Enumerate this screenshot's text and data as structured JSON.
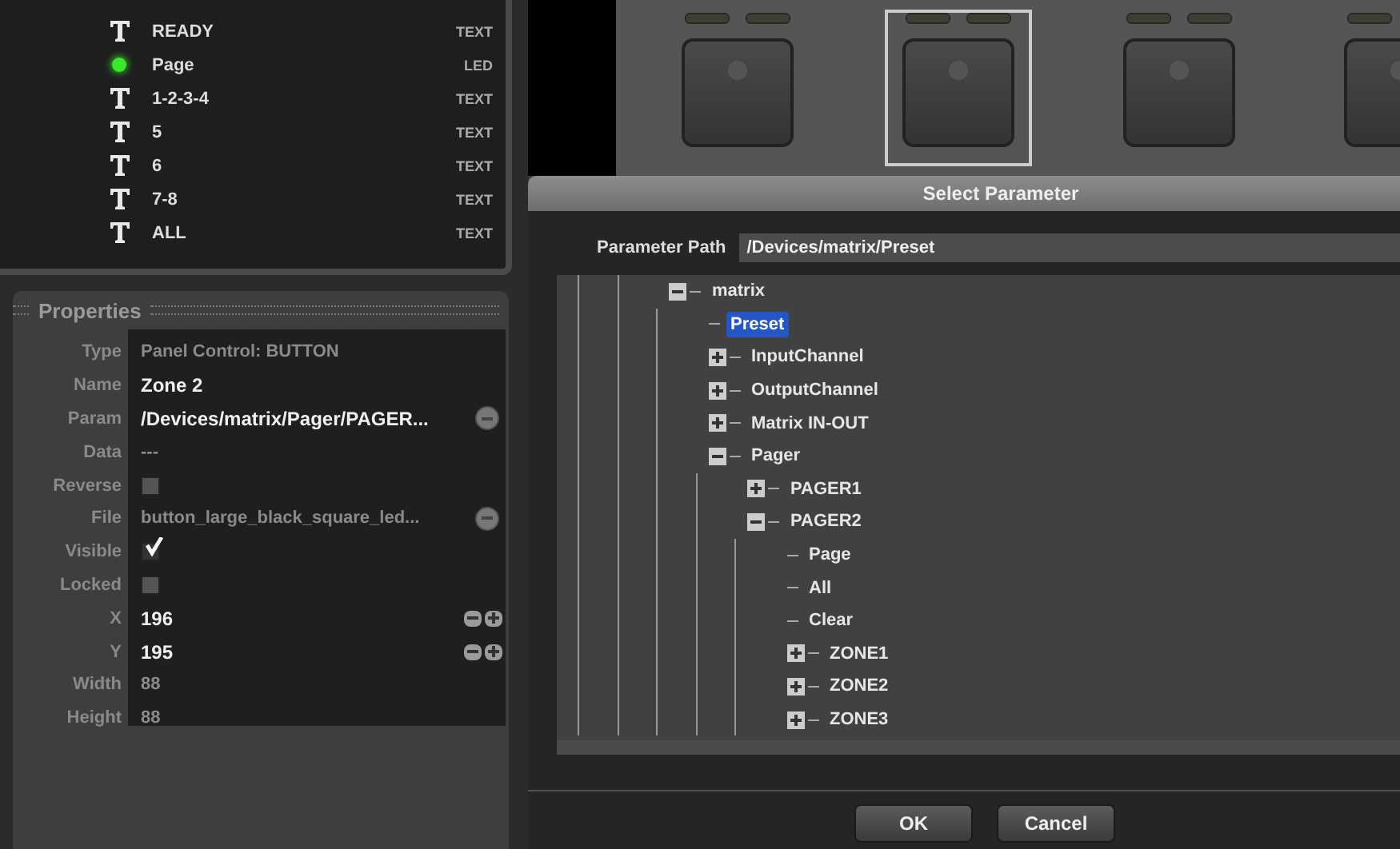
{
  "control_list": [
    {
      "kind": "text",
      "label": "READY",
      "type": "TEXT"
    },
    {
      "kind": "led",
      "label": "Page",
      "type": "LED"
    },
    {
      "kind": "text",
      "label": "1-2-3-4",
      "type": "TEXT"
    },
    {
      "kind": "text",
      "label": "5",
      "type": "TEXT"
    },
    {
      "kind": "text",
      "label": "6",
      "type": "TEXT"
    },
    {
      "kind": "text",
      "label": "7-8",
      "type": "TEXT"
    },
    {
      "kind": "text",
      "label": "ALL",
      "type": "TEXT"
    }
  ],
  "properties": {
    "title": "Properties",
    "rows": [
      {
        "kind": "text",
        "label": "Type",
        "value": "Panel Control: BUTTON",
        "disabled": true
      },
      {
        "kind": "text",
        "label": "Name",
        "value": "Zone 2",
        "disabled": false
      },
      {
        "kind": "browse",
        "label": "Param",
        "value": "/Devices/matrix/Pager/PAGER...",
        "disabled": false
      },
      {
        "kind": "text",
        "label": "Data",
        "value": "---",
        "disabled": true
      },
      {
        "kind": "checkbox",
        "label": "Reverse",
        "checked": false
      },
      {
        "kind": "browse",
        "label": "File",
        "value": "button_large_black_square_led...",
        "disabled": true
      },
      {
        "kind": "checkbox",
        "label": "Visible",
        "checked": true
      },
      {
        "kind": "checkbox",
        "label": "Locked",
        "checked": false
      },
      {
        "kind": "number",
        "label": "X",
        "value": "196",
        "disabled": false
      },
      {
        "kind": "number",
        "label": "Y",
        "value": "195",
        "disabled": false
      },
      {
        "kind": "text",
        "label": "Width",
        "value": "88",
        "disabled": true
      },
      {
        "kind": "text",
        "label": "Height",
        "value": "88",
        "disabled": true
      }
    ]
  },
  "canvas_buttons": [
    {
      "selected": false
    },
    {
      "selected": true
    },
    {
      "selected": false
    },
    {
      "selected": false
    }
  ],
  "dialog": {
    "title": "Select Parameter",
    "path_label": "Parameter Path",
    "path_value": "/Devices/matrix/Preset",
    "tree": [
      {
        "label": "matrix",
        "expanded": true,
        "selected": false,
        "children": [
          {
            "label": "Preset",
            "selected": true
          },
          {
            "label": "InputChannel",
            "expanded": false,
            "selected": false
          },
          {
            "label": "OutputChannel",
            "expanded": false,
            "selected": false
          },
          {
            "label": "Matrix IN-OUT",
            "expanded": false,
            "selected": false
          },
          {
            "label": "Pager",
            "expanded": true,
            "selected": false,
            "children": [
              {
                "label": "PAGER1",
                "expanded": false,
                "selected": false
              },
              {
                "label": "PAGER2",
                "expanded": true,
                "selected": false,
                "children": [
                  {
                    "label": "Page",
                    "selected": false
                  },
                  {
                    "label": "All",
                    "selected": false
                  },
                  {
                    "label": "Clear",
                    "selected": false
                  },
                  {
                    "label": "ZONE1",
                    "expanded": false,
                    "selected": false
                  },
                  {
                    "label": "ZONE2",
                    "expanded": false,
                    "selected": false
                  },
                  {
                    "label": "ZONE3",
                    "expanded": false,
                    "selected": false
                  }
                ]
              }
            ]
          }
        ]
      }
    ],
    "buttons": [
      "OK",
      "Cancel"
    ]
  }
}
